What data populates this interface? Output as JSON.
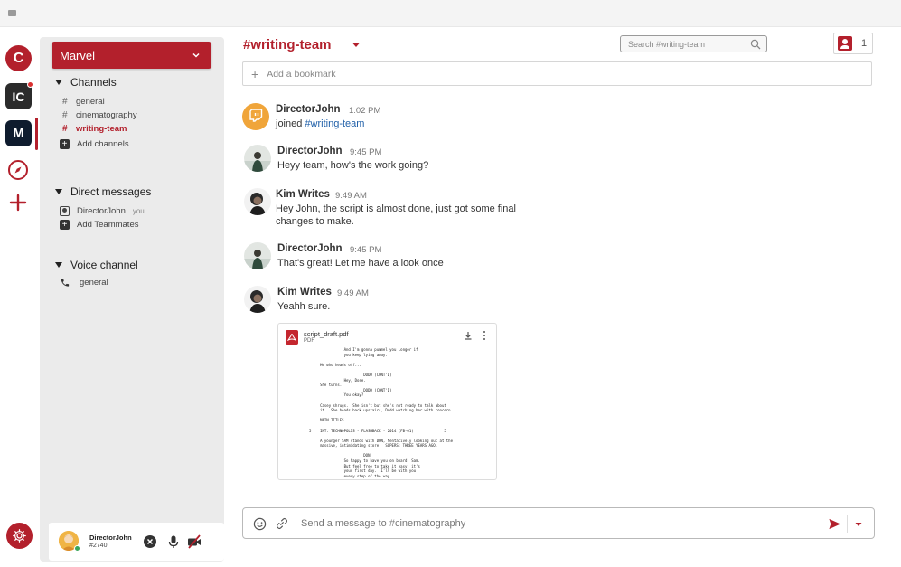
{
  "servers": [
    {
      "label": "C",
      "name": "server-c"
    },
    {
      "label": "IC",
      "name": "server-ic"
    },
    {
      "label": "M",
      "name": "server-m"
    }
  ],
  "workspace": {
    "name": "Marvel"
  },
  "sidebar": {
    "channels": {
      "header": "Channels",
      "items": [
        {
          "label": "general",
          "active": false
        },
        {
          "label": "cinematography",
          "active": false
        },
        {
          "label": "writing-team",
          "active": true
        }
      ],
      "add_label": "Add channels"
    },
    "direct_messages": {
      "header": "Direct messages",
      "items": [
        {
          "label": "DirectorJohn",
          "suffix": "you"
        }
      ],
      "add_label": "Add Teammates"
    },
    "voice": {
      "header": "Voice channel",
      "items": [
        {
          "label": "general"
        }
      ]
    }
  },
  "user": {
    "name": "DirectorJohn",
    "tag": "#2740"
  },
  "header": {
    "channel_title": "#writing-team",
    "search_placeholder": "Search #writing-team",
    "member_count": "1"
  },
  "bookmark": {
    "label": "Add a bookmark"
  },
  "messages": [
    {
      "author": "DirectorJohn",
      "time": "1:02 PM",
      "text_prefix": "joined ",
      "channel_link": "#writing-team"
    },
    {
      "author": "DirectorJohn",
      "time": "9:45 PM",
      "text": "Heyy team, how's the work going?"
    },
    {
      "author": "Kim Writes",
      "time": "9:49 AM",
      "text": "Hey John, the script is almost done, just got some final changes to make."
    },
    {
      "author": "DirectorJohn",
      "time": "9:45 PM",
      "text": "That's great! Let me have a look once"
    },
    {
      "author": "Kim Writes",
      "time": "9:49 AM",
      "text": "Yeahh sure."
    }
  ],
  "attachment": {
    "filename": "script_draft.pdf",
    "filetype": "PDF",
    "preview_lines": [
      "                     And I'm gonna pummel you longer if",
      "                     you keep lying away.",
      "",
      "          He who heads off...",
      "",
      "                              DODD (CONT'D)",
      "                     Hey, Dose.",
      "          She turns.",
      "                              DODD (CONT'D)",
      "                     You okay?",
      "",
      "          Casey shrugs.  She isn't but she's not ready to talk about",
      "          it.  She heads back upstairs, Dodd watching her with concern.",
      "",
      "          MAIN TITLES",
      "",
      "     5    INT. TECHNOPOLIS - FLASHBACK - 2014 (FB-01)              5",
      "",
      "          A younger SAM stands with DON, tentatively looking out at the",
      "          massive, intimidating store.  SUPERS: THREE YEARS AGO.",
      "",
      "                              DON",
      "                     So happy to have you on board, Sam.",
      "                     But feel free to take it easy, it's",
      "                     your first day.  I'll be with you",
      "                     every step of the way."
    ]
  },
  "composer": {
    "placeholder": "Send a message to #cinematography"
  },
  "colors": {
    "accent": "#b3202c",
    "sidebar_bg": "#ebebeb",
    "link": "#1f5fa8",
    "online": "#3ba55c"
  }
}
